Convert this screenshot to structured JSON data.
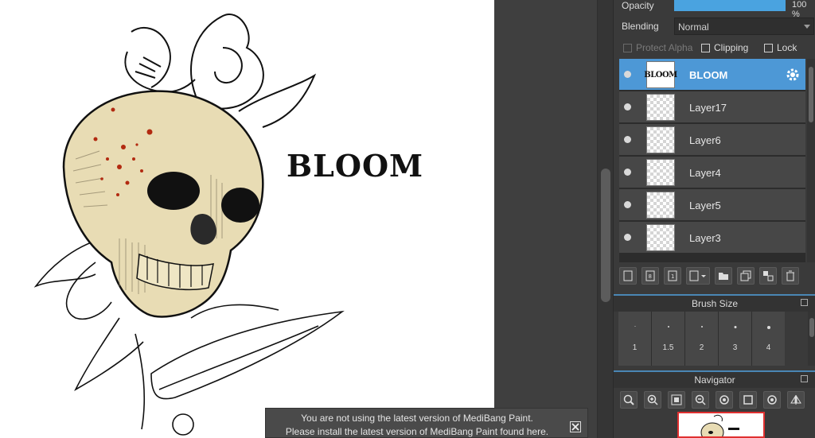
{
  "layer_props": {
    "opacity_label": "Opacity",
    "opacity_value": "100 %",
    "opacity_fraction": 1.0,
    "blending_label": "Blending",
    "blending_value": "Normal",
    "protect_alpha_label": "Protect Alpha",
    "clipping_label": "Clipping",
    "lock_label": "Lock"
  },
  "layers": [
    {
      "name": "BLOOM",
      "thumb_text": "BLOOM",
      "selected": true
    },
    {
      "name": "Layer17",
      "selected": false
    },
    {
      "name": "Layer6",
      "selected": false
    },
    {
      "name": "Layer4",
      "selected": false
    },
    {
      "name": "Layer5",
      "selected": false
    },
    {
      "name": "Layer3",
      "selected": false
    }
  ],
  "brush_size": {
    "title": "Brush Size",
    "sizes": [
      "1",
      "1.5",
      "2",
      "3",
      "4"
    ]
  },
  "navigator": {
    "title": "Navigator"
  },
  "canvas": {
    "artwork_text": "BLOOM"
  },
  "notification": {
    "line1": "You are not using the latest version of MediBang Paint.",
    "line2": "Please install the latest version of MediBang Paint found here."
  },
  "colors": {
    "accent": "#4d98d6",
    "panel_bg": "#3a3a3a",
    "skull": "#e8dcb4",
    "blood": "#b22a10"
  }
}
